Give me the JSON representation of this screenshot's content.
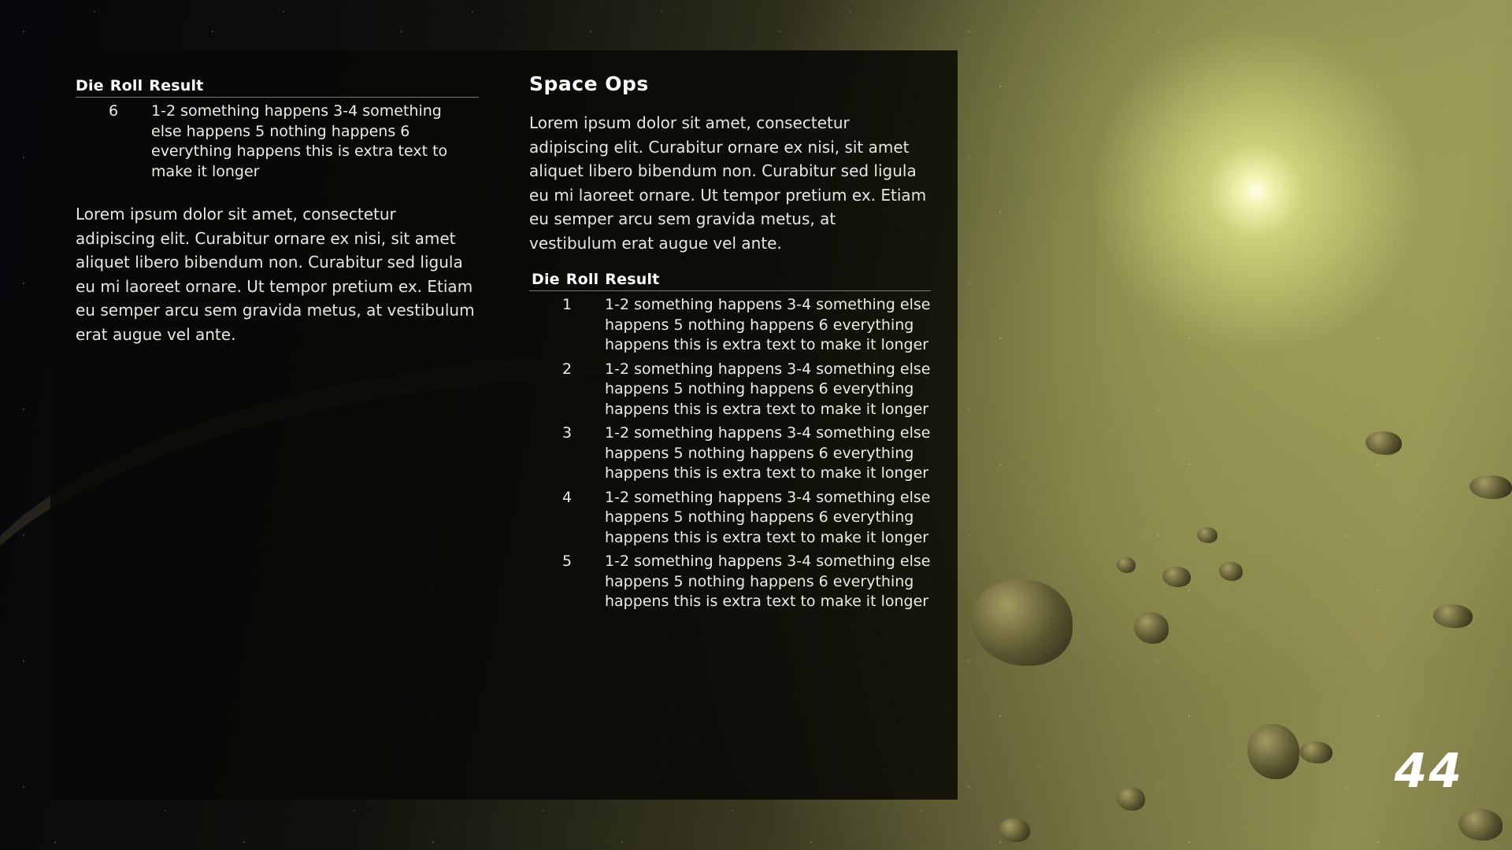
{
  "left_table": {
    "headers": [
      "Die",
      "Roll",
      "Result"
    ],
    "rows": [
      {
        "die": "6",
        "result": "1-2 something happens 3-4 something else happens 5 nothing happens 6 everything happens this is extra text to make it longer"
      }
    ]
  },
  "left_paragraph": "Lorem ipsum dolor sit amet, consectetur adipiscing elit. Curabitur ornare ex nisi, sit amet aliquet libero bibendum non. Curabitur sed ligula eu mi laoreet ornare. Ut tempor pretium ex. Etiam eu semper arcu sem gravida metus, at vestibulum erat augue vel ante.",
  "right_title": "Space Ops",
  "right_paragraph": "Lorem ipsum dolor sit amet, consectetur adipiscing elit. Curabitur ornare ex nisi, sit amet aliquet libero bibendum non. Curabitur sed ligula eu mi laoreet ornare. Ut tempor pretium ex. Etiam eu semper arcu sem gravida metus, at vestibulum erat augue vel ante.",
  "right_table": {
    "headers": [
      "Die",
      "Roll",
      "Result"
    ],
    "rows": [
      {
        "die": "1",
        "result": "1-2 something happens 3-4 something else happens 5 nothing happens 6 everything happens this is extra text to make it longer"
      },
      {
        "die": "2",
        "result": "1-2 something happens 3-4 something else happens 5 nothing happens 6 everything happens this is extra text to make it longer"
      },
      {
        "die": "3",
        "result": "1-2 something happens 3-4 something else happens 5 nothing happens 6 everything happens this is extra text to make it longer"
      },
      {
        "die": "4",
        "result": "1-2 something happens 3-4 something else happens 5 nothing happens 6 everything happens this is extra text to make it longer"
      },
      {
        "die": "5",
        "result": "1-2 something happens 3-4 something else happens 5 nothing happens 6 everything happens this is extra text to make it longer"
      }
    ]
  },
  "page_number": "44"
}
